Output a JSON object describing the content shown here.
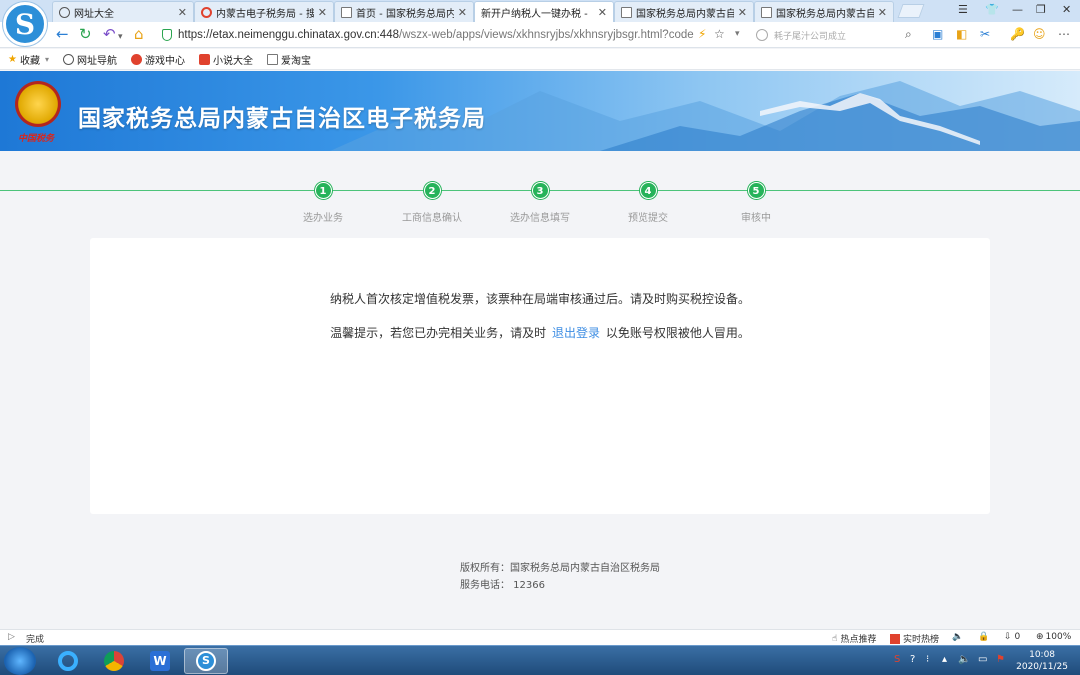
{
  "browser": {
    "tabs": [
      {
        "title": "网址大全",
        "icon": "globe-icon"
      },
      {
        "title": "内蒙古电子税务局 - 搜狗",
        "icon": "sogou-search-icon"
      },
      {
        "title": "首页 - 国家税务总局内蒙",
        "icon": "page-icon"
      },
      {
        "title": "新开户纳税人一键办税 -",
        "icon": "page-icon",
        "active": true
      },
      {
        "title": "国家税务总局内蒙古自治",
        "icon": "page-icon"
      },
      {
        "title": "国家税务总局内蒙古自治",
        "icon": "page-icon"
      }
    ],
    "url_host": "https://etax.neimenggu.chinatax.gov.cn:448",
    "url_path": "/wszx-web/apps/views/xkhnsryjbs/xkhnsryjbsgr.html?code",
    "search_placeholder": "耗子尾汁公司成立",
    "bookmarks": [
      "收藏",
      "网址导航",
      "游戏中心",
      "小说大全",
      "爱淘宝"
    ]
  },
  "banner": {
    "title": "国家税务总局内蒙古自治区电子税务局",
    "emblem_caption": "中国税务"
  },
  "steps": [
    {
      "num": "1",
      "label": "选办业务"
    },
    {
      "num": "2",
      "label": "工商信息确认"
    },
    {
      "num": "3",
      "label": "选办信息填写"
    },
    {
      "num": "4",
      "label": "预览提交"
    },
    {
      "num": "5",
      "label": "审核中"
    }
  ],
  "content": {
    "message1": "纳税人首次核定增值税发票，该票种在局端审核通过后。请及时购买税控设备。",
    "message2_prefix": "温馨提示，若您已办完相关业务，请及时",
    "logout_link": "退出登录",
    "message2_suffix": "以免账号权限被他人冒用。"
  },
  "footer": {
    "copyright": "版权所有：国家税务总局内蒙古自治区税务局",
    "phone": "服务电话： 12366"
  },
  "statusbar": {
    "status": "完成",
    "hot_recommend": "热点推荐",
    "realtime_hot": "实时热榜",
    "download_count": "0",
    "zoom": "100%"
  },
  "taskbar": {
    "time": "10:08",
    "date": "2020/11/25"
  },
  "colors": {
    "accent_green": "#26b35a",
    "link_blue": "#3e8ee3",
    "banner_blue": "#1e78d6"
  }
}
